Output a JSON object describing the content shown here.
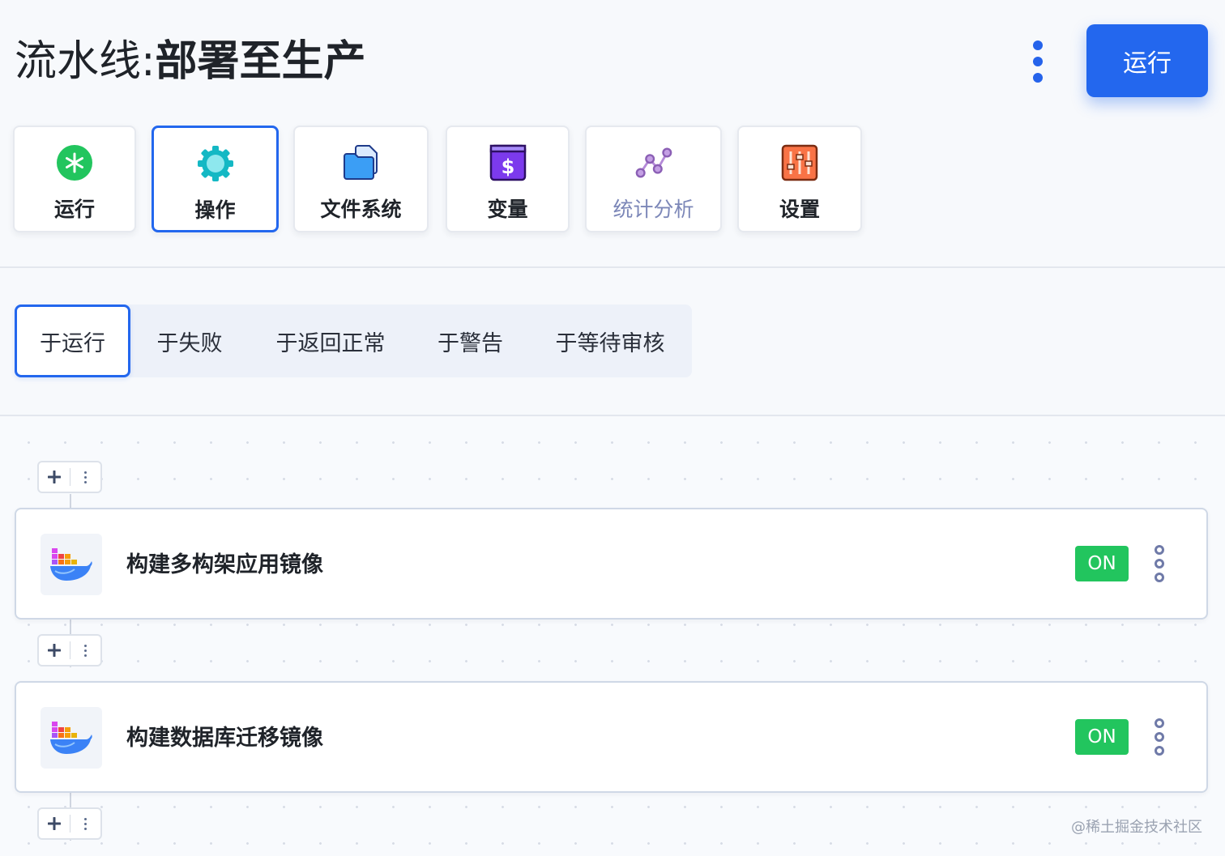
{
  "header": {
    "title_prefix": "流水线:",
    "title_name": "部署至生产",
    "run_button": "运行"
  },
  "tools": [
    {
      "label": "运行",
      "icon": "asterisk-circle-icon"
    },
    {
      "label": "操作",
      "icon": "gear-icon"
    },
    {
      "label": "文件系统",
      "icon": "folder-icon"
    },
    {
      "label": "变量",
      "icon": "dollar-icon"
    },
    {
      "label": "统计分析",
      "icon": "analytics-icon"
    },
    {
      "label": "设置",
      "icon": "sliders-icon"
    }
  ],
  "subtabs": [
    "于运行",
    "于失败",
    "于返回正常",
    "于警告",
    "于等待审核"
  ],
  "steps": [
    {
      "name": "构建多构架应用镜像",
      "toggle": "ON",
      "icon": "docker-icon"
    },
    {
      "name": "构建数据库迁移镜像",
      "toggle": "ON",
      "icon": "docker-icon"
    }
  ],
  "colors": {
    "accent": "#2367ee",
    "on_toggle": "#22c55e"
  },
  "watermark": "@稀土掘金技术社区"
}
